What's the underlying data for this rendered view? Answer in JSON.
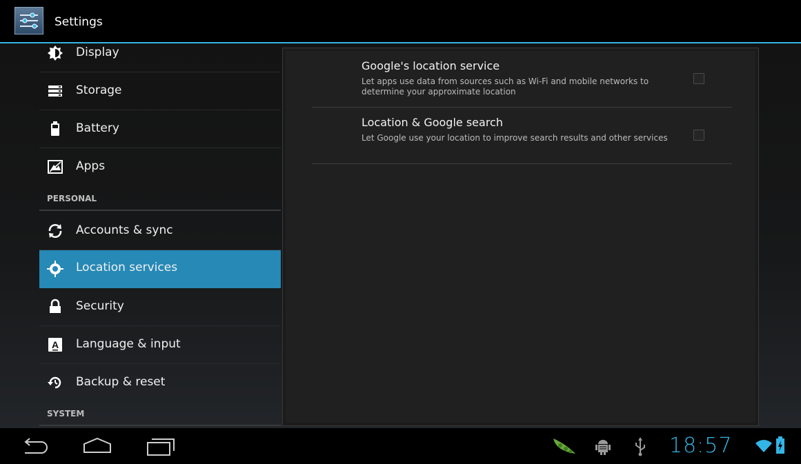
{
  "app": {
    "title": "Settings",
    "icon": "settings-sliders-icon"
  },
  "sidebar": {
    "items": [
      {
        "label": "Display",
        "icon": "brightness-icon"
      },
      {
        "label": "Storage",
        "icon": "storage-icon"
      },
      {
        "label": "Battery",
        "icon": "battery-icon"
      },
      {
        "label": "Apps",
        "icon": "apps-icon"
      },
      {
        "label": "Accounts & sync",
        "icon": "sync-icon"
      },
      {
        "label": "Location services",
        "icon": "location-icon",
        "selected": true
      },
      {
        "label": "Security",
        "icon": "lock-icon"
      },
      {
        "label": "Language & input",
        "icon": "keyboard-language-icon"
      },
      {
        "label": "Backup & reset",
        "icon": "backup-icon"
      }
    ],
    "sections": {
      "personal": "PERSONAL",
      "system": "SYSTEM"
    }
  },
  "main": {
    "prefs": [
      {
        "title": "Google's location service",
        "summary": "Let apps use data from sources such as Wi-Fi and mobile networks to determine your approximate location",
        "checked": false
      },
      {
        "title": "Location & Google search",
        "summary": "Let Google use your location to improve search results and other services",
        "checked": false
      }
    ]
  },
  "navbar": {
    "buttons": [
      "back-icon",
      "home-icon",
      "recent-apps-icon"
    ],
    "status": {
      "time": "18:57",
      "icons": [
        "notification-pea-pod-icon",
        "android-debug-icon",
        "usb-icon",
        "wifi-icon",
        "battery-charging-icon"
      ]
    }
  },
  "colors": {
    "accent": "#33b5e5",
    "selected": "#2689b6",
    "background": "#000000"
  }
}
